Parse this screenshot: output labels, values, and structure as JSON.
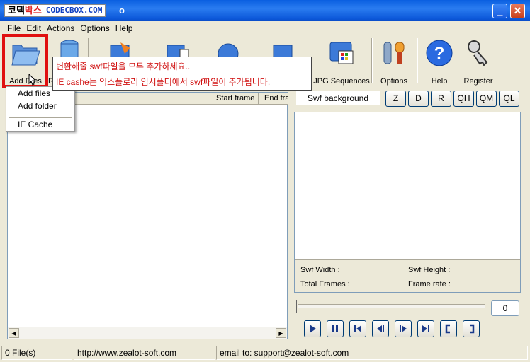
{
  "titlebar": {
    "logo_kr_1": "코덱",
    "logo_kr_2": "박스",
    "logo_en": "CODECBOX.COM",
    "title_tail": "o"
  },
  "menu": [
    "File",
    "Edit",
    "Actions",
    "Options",
    "Help"
  ],
  "toolbar": {
    "add_files_label": "Add Files",
    "hidden_label_fragment": "R",
    "jpg_label": "JPG Sequences",
    "options_label": "Options",
    "help_label": "Help",
    "register_label": "Register"
  },
  "tooltip": {
    "line1": "변환해줄 swf파일을 모두 추가하세요..",
    "line2": "IE cashe는 익스플로러 임시폴더에서 swf파일이 추가됩니다."
  },
  "dropdown": {
    "add_files": "Add files",
    "add_folder": "Add folder",
    "ie_cache": "IE Cache"
  },
  "filelist": {
    "col_start": "Start frame",
    "col_end": "End fra"
  },
  "preview": {
    "bg_label": "Swf background",
    "quality_buttons": [
      "Z",
      "D",
      "R",
      "QH",
      "QM",
      "QL"
    ],
    "swf_width": "Swf Width :",
    "swf_height": "Swf Height :",
    "total_frames": "Total Frames :",
    "frame_rate": "Frame rate :"
  },
  "playback": {
    "frame_value": "0",
    "buttons": [
      "play",
      "pause",
      "first",
      "prev",
      "next",
      "last",
      "mark-in",
      "mark-out"
    ]
  },
  "status": {
    "files": "0 File(s)",
    "url": "http://www.zealot-soft.com",
    "email": "email to: support@zealot-soft.com"
  },
  "colors": {
    "highlight": "#e01010",
    "tooltip_text": "#d01010",
    "titlebar": "#0a5fe0"
  }
}
